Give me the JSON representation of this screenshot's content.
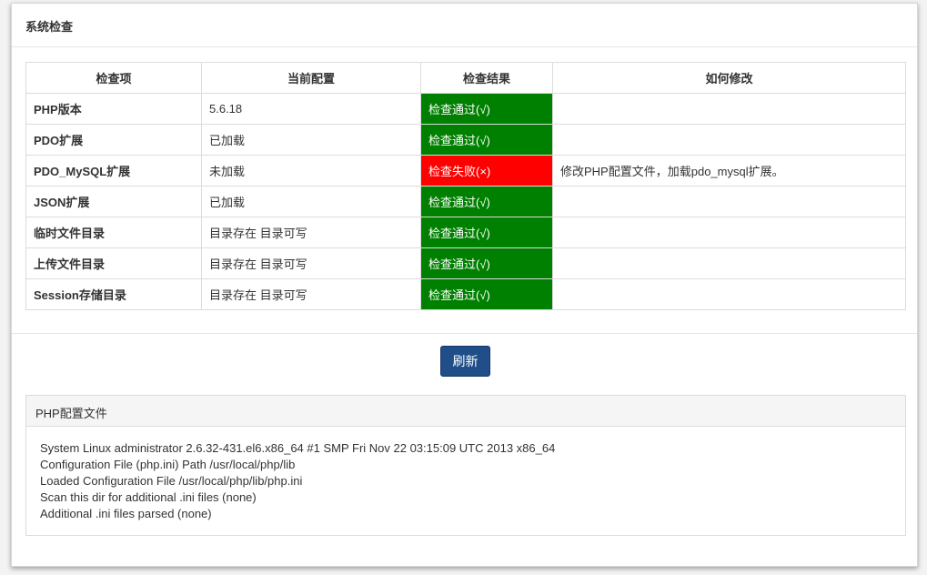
{
  "title": "系统检查",
  "table": {
    "headers": [
      "检查项",
      "当前配置",
      "检查结果",
      "如何修改"
    ],
    "rows": [
      {
        "item": "PHP版本",
        "value": "5.6.18",
        "result": "检查通过(√)",
        "status": "pass",
        "fix": ""
      },
      {
        "item": "PDO扩展",
        "value": "已加载",
        "result": "检查通过(√)",
        "status": "pass",
        "fix": ""
      },
      {
        "item": "PDO_MySQL扩展",
        "value": "未加载",
        "result": "检查失败(×)",
        "status": "fail",
        "fix": "修改PHP配置文件，加载pdo_mysql扩展。"
      },
      {
        "item": "JSON扩展",
        "value": "已加载",
        "result": "检查通过(√)",
        "status": "pass",
        "fix": ""
      },
      {
        "item": "临时文件目录",
        "value": "目录存在 目录可写",
        "result": "检查通过(√)",
        "status": "pass",
        "fix": ""
      },
      {
        "item": "上传文件目录",
        "value": "目录存在 目录可写",
        "result": "检查通过(√)",
        "status": "pass",
        "fix": ""
      },
      {
        "item": "Session存储目录",
        "value": "目录存在 目录可写",
        "result": "检查通过(√)",
        "status": "pass",
        "fix": ""
      }
    ]
  },
  "refresh_label": "刷新",
  "ini": {
    "title": "PHP配置文件",
    "lines": [
      "System Linux administrator 2.6.32-431.el6.x86_64 #1 SMP Fri Nov 22 03:15:09 UTC 2013 x86_64",
      "Configuration File (php.ini) Path /usr/local/php/lib",
      "Loaded Configuration File /usr/local/php/lib/php.ini",
      "Scan this dir for additional .ini files (none)",
      "Additional .ini files parsed (none)"
    ]
  },
  "colors": {
    "pass": "#008000",
    "fail": "#ff0000",
    "button": "#1f4e88"
  }
}
